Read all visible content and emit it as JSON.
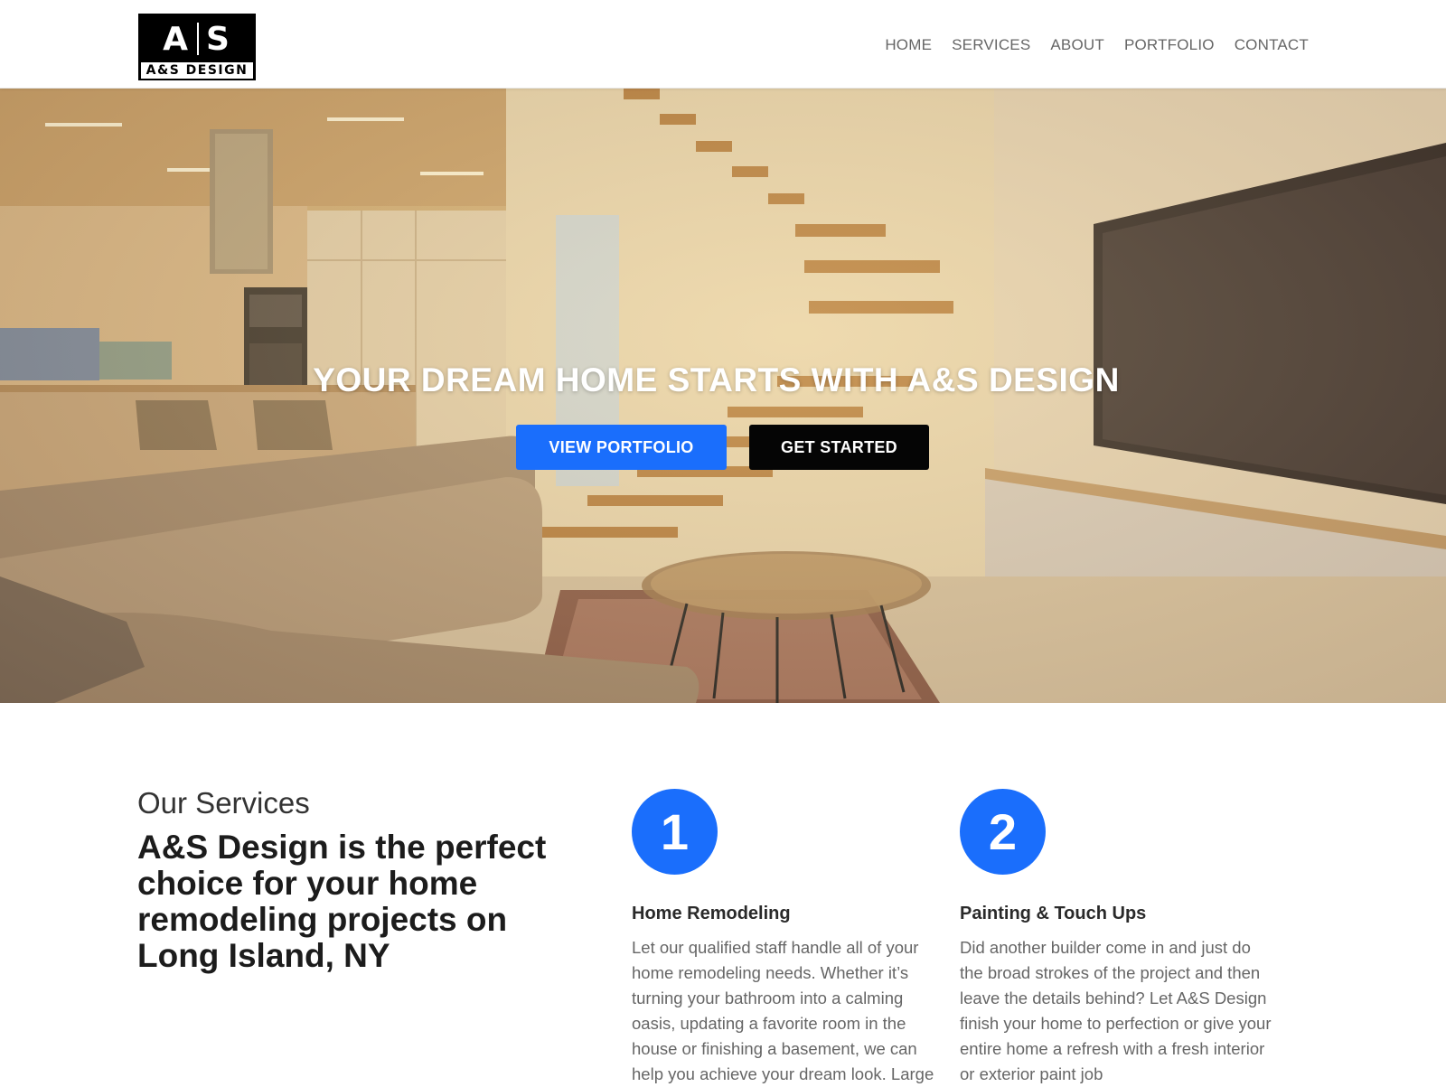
{
  "header": {
    "logo": {
      "mark_left": "A",
      "mark_right": "S",
      "sub": "A&S DESIGN"
    },
    "nav": [
      "HOME",
      "SERVICES",
      "ABOUT",
      "PORTFOLIO",
      "CONTACT"
    ]
  },
  "hero": {
    "title": "YOUR DREAM HOME STARTS WITH A&S DESIGN",
    "buttons": {
      "portfolio": "VIEW PORTFOLIO",
      "started": "GET STARTED"
    }
  },
  "services": {
    "eyebrow": "Our Services",
    "heading": "A&S Design is the perfect choice for your home remodeling projects on Long Island, NY",
    "cards": [
      {
        "number": "1",
        "title": "Home Remodeling",
        "text": "Let our qualified staff handle all of your home remodeling needs. Whether it’s turning your bathroom into a calming oasis, updating a favorite room in the house or finishing a basement, we can help you achieve your dream look. Large"
      },
      {
        "number": "2",
        "title": "Painting & Touch Ups",
        "text": "Did another builder come in and just do the broad strokes of the project and then leave the details behind? Let A&S Design finish your home to perfection or give your entire home a refresh with a fresh interior or exterior paint job"
      }
    ]
  },
  "colors": {
    "accent": "#1a6efc",
    "dark_button": "#050505"
  }
}
